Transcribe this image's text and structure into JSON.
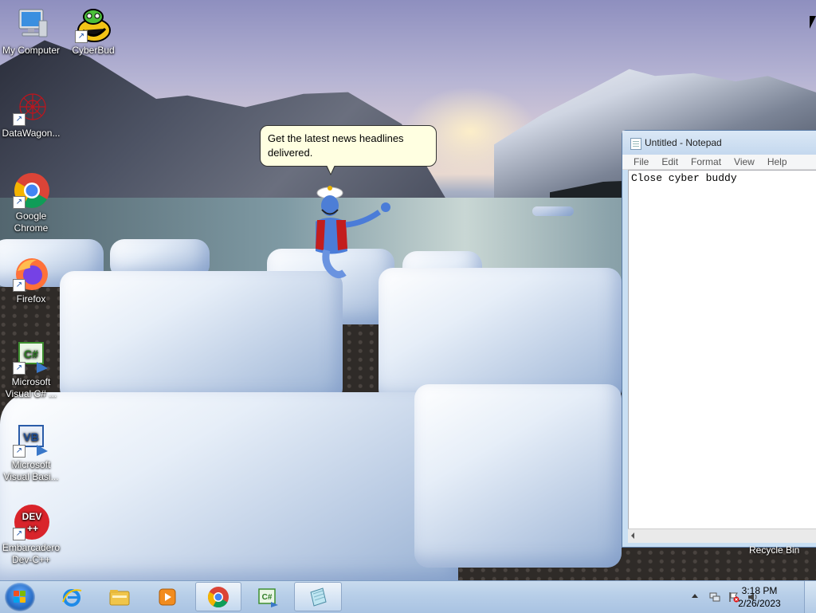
{
  "desktop": {
    "icons": [
      {
        "label": "My Computer"
      },
      {
        "label": "CyberBud"
      },
      {
        "label": "DataWagon..."
      },
      {
        "label": "Google Chrome"
      },
      {
        "label": "Firefox"
      },
      {
        "label": "Microsoft Visual C# ..."
      },
      {
        "label": "Microsoft Visual Basi..."
      },
      {
        "label": "Embarcadero Dev-C++"
      }
    ],
    "recycle_bin_label": "Recycle Bin"
  },
  "genie": {
    "balloon_text": "Get the latest news headlines delivered."
  },
  "notepad": {
    "title": "Untitled - Notepad",
    "menu": [
      "File",
      "Edit",
      "Format",
      "View",
      "Help"
    ],
    "content": "Close cyber buddy"
  },
  "taskbar": {
    "pinned": [
      "Internet Explorer",
      "Windows Explorer",
      "Windows Media Player",
      "Google Chrome",
      "Microsoft Visual C#",
      "Notepad"
    ],
    "active": "Notepad",
    "clock": {
      "time": "3:18 PM",
      "date": "2/26/2023"
    },
    "accent": "#2a6fc8"
  }
}
